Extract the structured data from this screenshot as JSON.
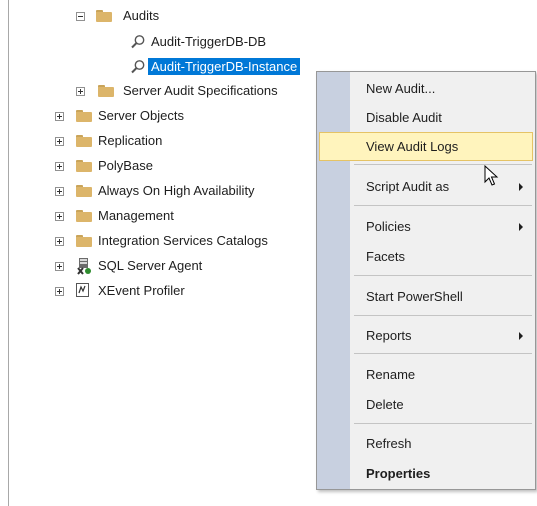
{
  "tree": {
    "audits_folder": "Audits",
    "audit_items": [
      "Audit-TriggerDB-DB",
      "Audit-TriggerDB-Instance"
    ],
    "server_audit_specs": "Server Audit Specifications",
    "server_objects": "Server Objects",
    "replication": "Replication",
    "polybase": "PolyBase",
    "always_on": "Always On High Availability",
    "management": "Management",
    "integration_services": "Integration Services Catalogs",
    "sql_agent": "SQL Server Agent",
    "xevent_profiler": "XEvent Profiler"
  },
  "menu": {
    "new_audit": "New Audit...",
    "disable_audit": "Disable Audit",
    "view_audit_logs": "View Audit Logs",
    "script_audit_as": "Script Audit as",
    "policies": "Policies",
    "facets": "Facets",
    "start_powershell": "Start PowerShell",
    "reports": "Reports",
    "rename": "Rename",
    "delete": "Delete",
    "refresh": "Refresh",
    "properties": "Properties"
  },
  "colors": {
    "selection": "#0078d7",
    "menu_hover": "#fff4bd",
    "menu_gutter": "#c8d0e0",
    "folder": "#dcb56a"
  }
}
